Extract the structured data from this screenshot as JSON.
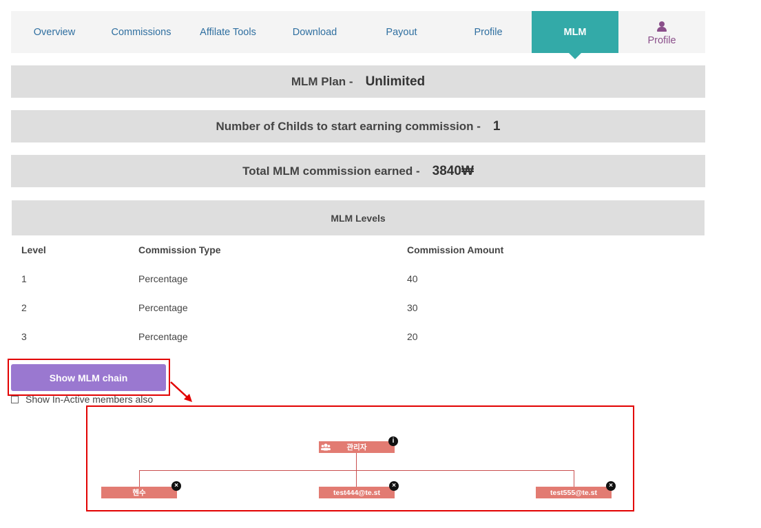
{
  "nav": {
    "tabs": [
      {
        "label": "Overview"
      },
      {
        "label": "Commissions"
      },
      {
        "label": "Affilate Tools"
      },
      {
        "label": "Download"
      },
      {
        "label": "Payout"
      },
      {
        "label": "Profile"
      },
      {
        "label": "MLM",
        "active": true
      },
      {
        "label": "Profile",
        "icon": "user-icon"
      }
    ]
  },
  "summary": {
    "plan_label": "MLM Plan -",
    "plan_value": "Unlimited",
    "childs_label": "Number of Childs to start earning commission -",
    "childs_value": "1",
    "total_label": "Total MLM commission earned -",
    "total_value": "3840₩"
  },
  "levels": {
    "title": "MLM Levels",
    "columns": [
      "Level",
      "Commission Type",
      "Commission Amount"
    ],
    "rows": [
      [
        "1",
        "Percentage",
        "40"
      ],
      [
        "2",
        "Percentage",
        "30"
      ],
      [
        "3",
        "Percentage",
        "20"
      ]
    ]
  },
  "chain": {
    "button_label": "Show MLM chain",
    "inactive_label": "Show In-Active members also",
    "root": {
      "name": "관리자",
      "icon": "users-icon",
      "badge": "info-icon"
    },
    "children": [
      {
        "name": "헨수",
        "badge": "close-icon"
      },
      {
        "name": "test444@te.st",
        "badge": "close-icon"
      },
      {
        "name": "test555@te.st",
        "badge": "close-icon"
      }
    ]
  },
  "colors": {
    "accent": "#33aaa8",
    "button": "#9a78d0",
    "node": "#e27b72",
    "highlight": "#e20000"
  }
}
